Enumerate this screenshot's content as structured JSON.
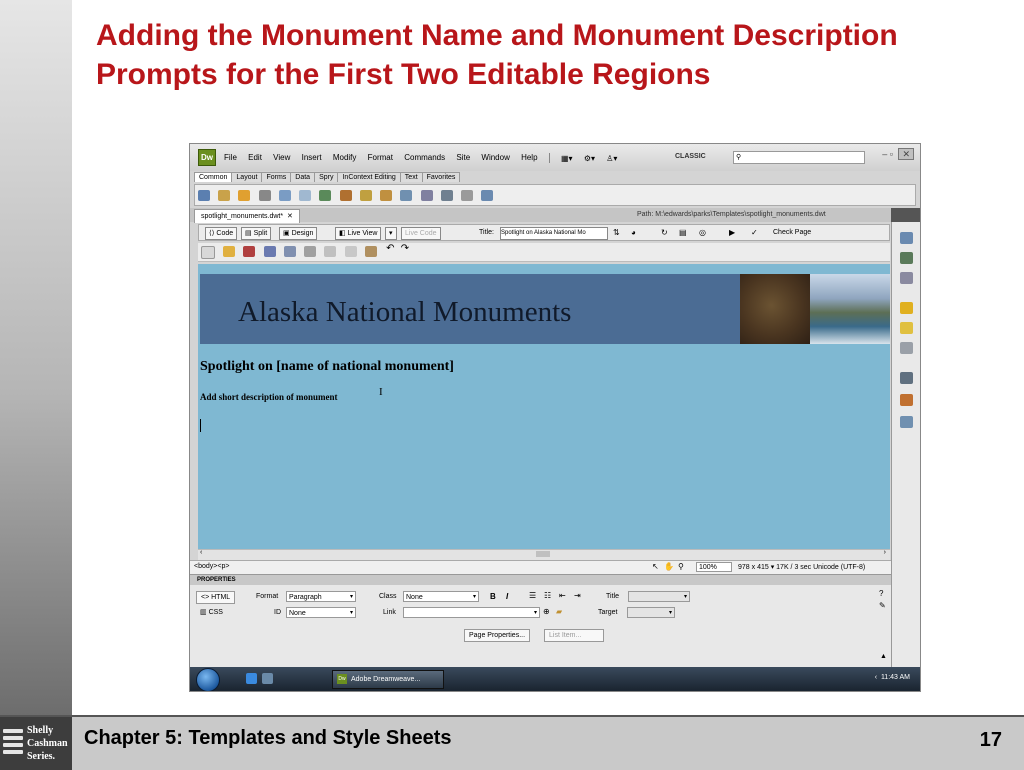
{
  "slide": {
    "title_line1": "Adding the Monument Name and Monument Description",
    "title_line2": "Prompts for the First Two Editable Regions",
    "footer_chapter": "Chapter 5: Templates and Style Sheets",
    "page_number": "17",
    "logo_lines": [
      "Shelly",
      "Cashman",
      "Series."
    ]
  },
  "app": {
    "logo": "Dw",
    "menus": [
      "File",
      "Edit",
      "View",
      "Insert",
      "Modify",
      "Format",
      "Commands",
      "Site",
      "Window",
      "Help"
    ],
    "workspace": "CLASSIC",
    "insert_tabs": [
      "Common",
      "Layout",
      "Forms",
      "Data",
      "Spry",
      "InContext Editing",
      "Text",
      "Favorites"
    ],
    "doc_tab": "spotlight_monuments.dwt*",
    "path": "Path:  M:\\edwards\\parks\\Templates\\spotlight_monuments.dwt",
    "view_buttons": [
      "Code",
      "Split",
      "Design",
      "Live View",
      "Live Code"
    ],
    "title_label": "Title:",
    "title_value": "Spotlight on Alaska National Mo",
    "check_page": "Check Page"
  },
  "design": {
    "banner_title": "Alaska National Monuments",
    "spotlight": "Spotlight on [name of national monument]",
    "short_desc": "Add short description of monument"
  },
  "status": {
    "tag_selector": "<body><p>",
    "zoom": "100%",
    "dims": "978 x 415 ▾  17K / 3 sec  Unicode (UTF-8)"
  },
  "properties": {
    "header": "PROPERTIES",
    "html": "HTML",
    "css": "CSS",
    "format_label": "Format",
    "format_value": "Paragraph",
    "id_label": "ID",
    "id_value": "None",
    "class_label": "Class",
    "class_value": "None",
    "link_label": "Link",
    "bold": "B",
    "italic": "I",
    "title_label": "Title",
    "target_label": "Target",
    "page_properties": "Page Properties...",
    "list_item": "List Item..."
  },
  "taskbar": {
    "app_button": "Adobe Dreamweave...",
    "clock": "11:43 AM"
  }
}
